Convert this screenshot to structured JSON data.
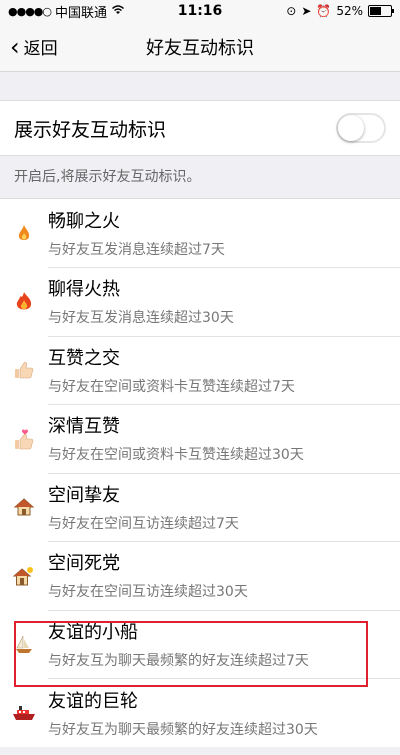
{
  "status_bar": {
    "carrier": "中国联通",
    "time": "11:16",
    "battery": "52%",
    "battery_level": 0.52,
    "wifi_icon": "wifi-icon",
    "lock_icon": "rotation-lock-icon",
    "location_icon": "location-icon",
    "alarm_icon": "alarm-icon"
  },
  "nav": {
    "back_label": "返回",
    "title": "好友互动标识"
  },
  "toggle": {
    "label": "展示好友互动标识",
    "enabled": false
  },
  "hint": "开启后,将展示好友互动标识。",
  "items": [
    {
      "title": "畅聊之火",
      "desc": "与好友互发消息连续超过7天",
      "icon": "small-flame-icon"
    },
    {
      "title": "聊得火热",
      "desc": "与好友互发消息连续超过30天",
      "icon": "big-flame-icon"
    },
    {
      "title": "互赞之交",
      "desc": "与好友在空间或资料卡互赞连续超过7天",
      "icon": "thumbs-up-icon"
    },
    {
      "title": "深情互赞",
      "desc": "与好友在空间或资料卡互赞连续超过30天",
      "icon": "thumbs-up-heart-icon"
    },
    {
      "title": "空间挚友",
      "desc": "与好友在空间互访连续超过7天",
      "icon": "house-icon"
    },
    {
      "title": "空间死党",
      "desc": "与好友在空间互访连续超过30天",
      "icon": "house-sun-icon"
    },
    {
      "title": "友谊的小船",
      "desc": "与好友互为聊天最频繁的好友连续超过7天",
      "icon": "sailboat-icon"
    },
    {
      "title": "友谊的巨轮",
      "desc": "与好友互为聊天最频繁的好友连续超过30天",
      "icon": "ship-icon"
    }
  ],
  "colors": {
    "highlight": "#e0202e",
    "background": "#efeff4"
  }
}
